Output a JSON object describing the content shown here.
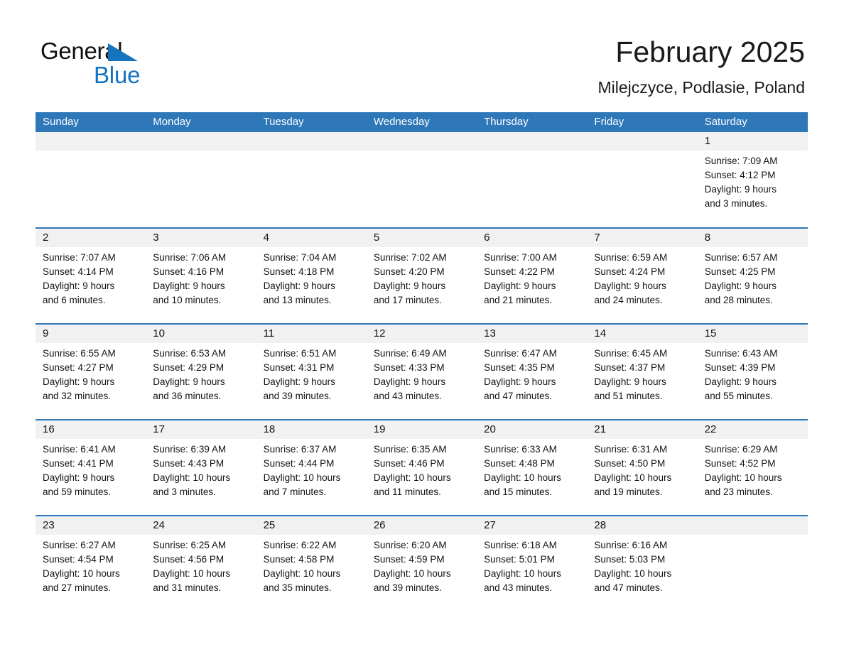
{
  "brand": {
    "name_part1": "General",
    "name_part2": "Blue",
    "accent_color": "#1272c4",
    "triangle_color": "#1574bd"
  },
  "header": {
    "title": "February 2025",
    "subtitle": "Milejczyce, Podlasie, Poland"
  },
  "calendar": {
    "header_bg": "#2e77b8",
    "daynumber_bg": "#f1f1f1",
    "weekdays": [
      "Sunday",
      "Monday",
      "Tuesday",
      "Wednesday",
      "Thursday",
      "Friday",
      "Saturday"
    ],
    "weeks": [
      [
        {
          "day": "",
          "lines": []
        },
        {
          "day": "",
          "lines": []
        },
        {
          "day": "",
          "lines": []
        },
        {
          "day": "",
          "lines": []
        },
        {
          "day": "",
          "lines": []
        },
        {
          "day": "",
          "lines": []
        },
        {
          "day": "1",
          "sunrise": "Sunrise: 7:09 AM",
          "sunset": "Sunset: 4:12 PM",
          "daylight1": "Daylight: 9 hours",
          "daylight2": "and 3 minutes."
        }
      ],
      [
        {
          "day": "2",
          "sunrise": "Sunrise: 7:07 AM",
          "sunset": "Sunset: 4:14 PM",
          "daylight1": "Daylight: 9 hours",
          "daylight2": "and 6 minutes."
        },
        {
          "day": "3",
          "sunrise": "Sunrise: 7:06 AM",
          "sunset": "Sunset: 4:16 PM",
          "daylight1": "Daylight: 9 hours",
          "daylight2": "and 10 minutes."
        },
        {
          "day": "4",
          "sunrise": "Sunrise: 7:04 AM",
          "sunset": "Sunset: 4:18 PM",
          "daylight1": "Daylight: 9 hours",
          "daylight2": "and 13 minutes."
        },
        {
          "day": "5",
          "sunrise": "Sunrise: 7:02 AM",
          "sunset": "Sunset: 4:20 PM",
          "daylight1": "Daylight: 9 hours",
          "daylight2": "and 17 minutes."
        },
        {
          "day": "6",
          "sunrise": "Sunrise: 7:00 AM",
          "sunset": "Sunset: 4:22 PM",
          "daylight1": "Daylight: 9 hours",
          "daylight2": "and 21 minutes."
        },
        {
          "day": "7",
          "sunrise": "Sunrise: 6:59 AM",
          "sunset": "Sunset: 4:24 PM",
          "daylight1": "Daylight: 9 hours",
          "daylight2": "and 24 minutes."
        },
        {
          "day": "8",
          "sunrise": "Sunrise: 6:57 AM",
          "sunset": "Sunset: 4:25 PM",
          "daylight1": "Daylight: 9 hours",
          "daylight2": "and 28 minutes."
        }
      ],
      [
        {
          "day": "9",
          "sunrise": "Sunrise: 6:55 AM",
          "sunset": "Sunset: 4:27 PM",
          "daylight1": "Daylight: 9 hours",
          "daylight2": "and 32 minutes."
        },
        {
          "day": "10",
          "sunrise": "Sunrise: 6:53 AM",
          "sunset": "Sunset: 4:29 PM",
          "daylight1": "Daylight: 9 hours",
          "daylight2": "and 36 minutes."
        },
        {
          "day": "11",
          "sunrise": "Sunrise: 6:51 AM",
          "sunset": "Sunset: 4:31 PM",
          "daylight1": "Daylight: 9 hours",
          "daylight2": "and 39 minutes."
        },
        {
          "day": "12",
          "sunrise": "Sunrise: 6:49 AM",
          "sunset": "Sunset: 4:33 PM",
          "daylight1": "Daylight: 9 hours",
          "daylight2": "and 43 minutes."
        },
        {
          "day": "13",
          "sunrise": "Sunrise: 6:47 AM",
          "sunset": "Sunset: 4:35 PM",
          "daylight1": "Daylight: 9 hours",
          "daylight2": "and 47 minutes."
        },
        {
          "day": "14",
          "sunrise": "Sunrise: 6:45 AM",
          "sunset": "Sunset: 4:37 PM",
          "daylight1": "Daylight: 9 hours",
          "daylight2": "and 51 minutes."
        },
        {
          "day": "15",
          "sunrise": "Sunrise: 6:43 AM",
          "sunset": "Sunset: 4:39 PM",
          "daylight1": "Daylight: 9 hours",
          "daylight2": "and 55 minutes."
        }
      ],
      [
        {
          "day": "16",
          "sunrise": "Sunrise: 6:41 AM",
          "sunset": "Sunset: 4:41 PM",
          "daylight1": "Daylight: 9 hours",
          "daylight2": "and 59 minutes."
        },
        {
          "day": "17",
          "sunrise": "Sunrise: 6:39 AM",
          "sunset": "Sunset: 4:43 PM",
          "daylight1": "Daylight: 10 hours",
          "daylight2": "and 3 minutes."
        },
        {
          "day": "18",
          "sunrise": "Sunrise: 6:37 AM",
          "sunset": "Sunset: 4:44 PM",
          "daylight1": "Daylight: 10 hours",
          "daylight2": "and 7 minutes."
        },
        {
          "day": "19",
          "sunrise": "Sunrise: 6:35 AM",
          "sunset": "Sunset: 4:46 PM",
          "daylight1": "Daylight: 10 hours",
          "daylight2": "and 11 minutes."
        },
        {
          "day": "20",
          "sunrise": "Sunrise: 6:33 AM",
          "sunset": "Sunset: 4:48 PM",
          "daylight1": "Daylight: 10 hours",
          "daylight2": "and 15 minutes."
        },
        {
          "day": "21",
          "sunrise": "Sunrise: 6:31 AM",
          "sunset": "Sunset: 4:50 PM",
          "daylight1": "Daylight: 10 hours",
          "daylight2": "and 19 minutes."
        },
        {
          "day": "22",
          "sunrise": "Sunrise: 6:29 AM",
          "sunset": "Sunset: 4:52 PM",
          "daylight1": "Daylight: 10 hours",
          "daylight2": "and 23 minutes."
        }
      ],
      [
        {
          "day": "23",
          "sunrise": "Sunrise: 6:27 AM",
          "sunset": "Sunset: 4:54 PM",
          "daylight1": "Daylight: 10 hours",
          "daylight2": "and 27 minutes."
        },
        {
          "day": "24",
          "sunrise": "Sunrise: 6:25 AM",
          "sunset": "Sunset: 4:56 PM",
          "daylight1": "Daylight: 10 hours",
          "daylight2": "and 31 minutes."
        },
        {
          "day": "25",
          "sunrise": "Sunrise: 6:22 AM",
          "sunset": "Sunset: 4:58 PM",
          "daylight1": "Daylight: 10 hours",
          "daylight2": "and 35 minutes."
        },
        {
          "day": "26",
          "sunrise": "Sunrise: 6:20 AM",
          "sunset": "Sunset: 4:59 PM",
          "daylight1": "Daylight: 10 hours",
          "daylight2": "and 39 minutes."
        },
        {
          "day": "27",
          "sunrise": "Sunrise: 6:18 AM",
          "sunset": "Sunset: 5:01 PM",
          "daylight1": "Daylight: 10 hours",
          "daylight2": "and 43 minutes."
        },
        {
          "day": "28",
          "sunrise": "Sunrise: 6:16 AM",
          "sunset": "Sunset: 5:03 PM",
          "daylight1": "Daylight: 10 hours",
          "daylight2": "and 47 minutes."
        },
        {
          "day": "",
          "lines": []
        }
      ]
    ]
  }
}
